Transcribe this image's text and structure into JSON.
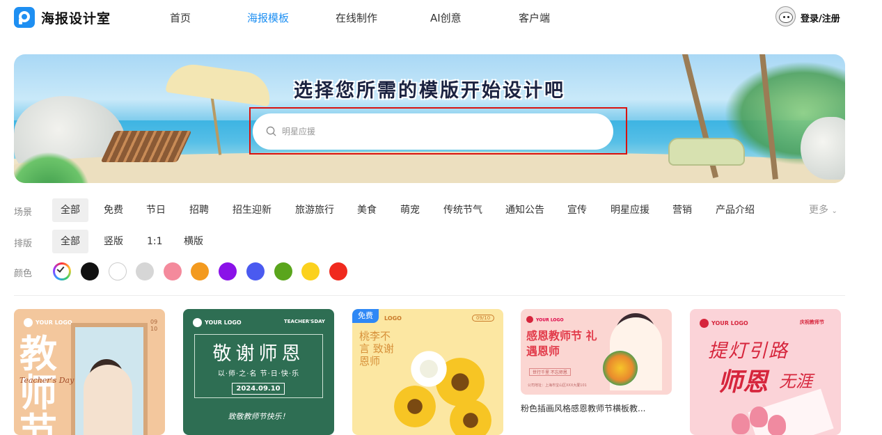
{
  "brand": {
    "name": "海报设计室",
    "icon": "poster-logo-icon",
    "color": "#1e8ff2"
  },
  "nav": [
    "首页",
    "海报模板",
    "在线制作",
    "AI创意",
    "客户端"
  ],
  "nav_active": "海报模板",
  "header_right": {
    "avatar_icon": "cat-avatar-icon",
    "login": "登录/注册"
  },
  "banner": {
    "title": "选择您所需的模版开始设计吧",
    "search_placeholder": "明星应援"
  },
  "filters": {
    "scene": {
      "label": "场景",
      "options": [
        "全部",
        "免费",
        "节日",
        "招聘",
        "招生迎新",
        "旅游旅行",
        "美食",
        "萌宠",
        "传统节气",
        "通知公告",
        "宣传",
        "明星应援",
        "营销",
        "产品介绍"
      ],
      "selected": "全部",
      "more": "更多"
    },
    "layout": {
      "label": "排版",
      "options": [
        "全部",
        "竖版",
        "1:1",
        "横版"
      ],
      "selected": "全部"
    },
    "color": {
      "label": "颜色",
      "swatches": [
        "all",
        "#111111",
        "#ffffff",
        "#d6d6d6",
        "#f48a9c",
        "#f39a1f",
        "#8a12e8",
        "#4a5af0",
        "#5aa51c",
        "#fbd11e",
        "#f02a1e"
      ],
      "selected": "all"
    }
  },
  "templates": [
    {
      "logo": "YOUR LOGO",
      "title_big": "教师节",
      "script": "Teacher's Day",
      "side": "09 10"
    },
    {
      "logo": "YOUR LOGO",
      "corner": "TEACHER'SDAY",
      "title": "敬谢师恩",
      "subtitle": "以·师·之·名 节·日·快·乐",
      "date": "2024.09.10",
      "slogan": "致敬教师节快乐！"
    },
    {
      "badge": "免费",
      "logo": "LOGO",
      "date_tag": "09/10",
      "vertical_text": "桃李不言 致谢恩师"
    },
    {
      "logo": "YOUR LOGO",
      "title": "感恩教师节 礼遇恩师",
      "tag": "世行千里 不忘师恩",
      "small": "公司地址：上海市宝山区XXX大厦101",
      "caption": "粉色插画风格感恩教师节横板教..."
    },
    {
      "logo": "YOUR LOGO",
      "corner": "庆祝教师节",
      "line1": "提灯引路",
      "line2": "师恩",
      "line3": "无涯"
    }
  ]
}
